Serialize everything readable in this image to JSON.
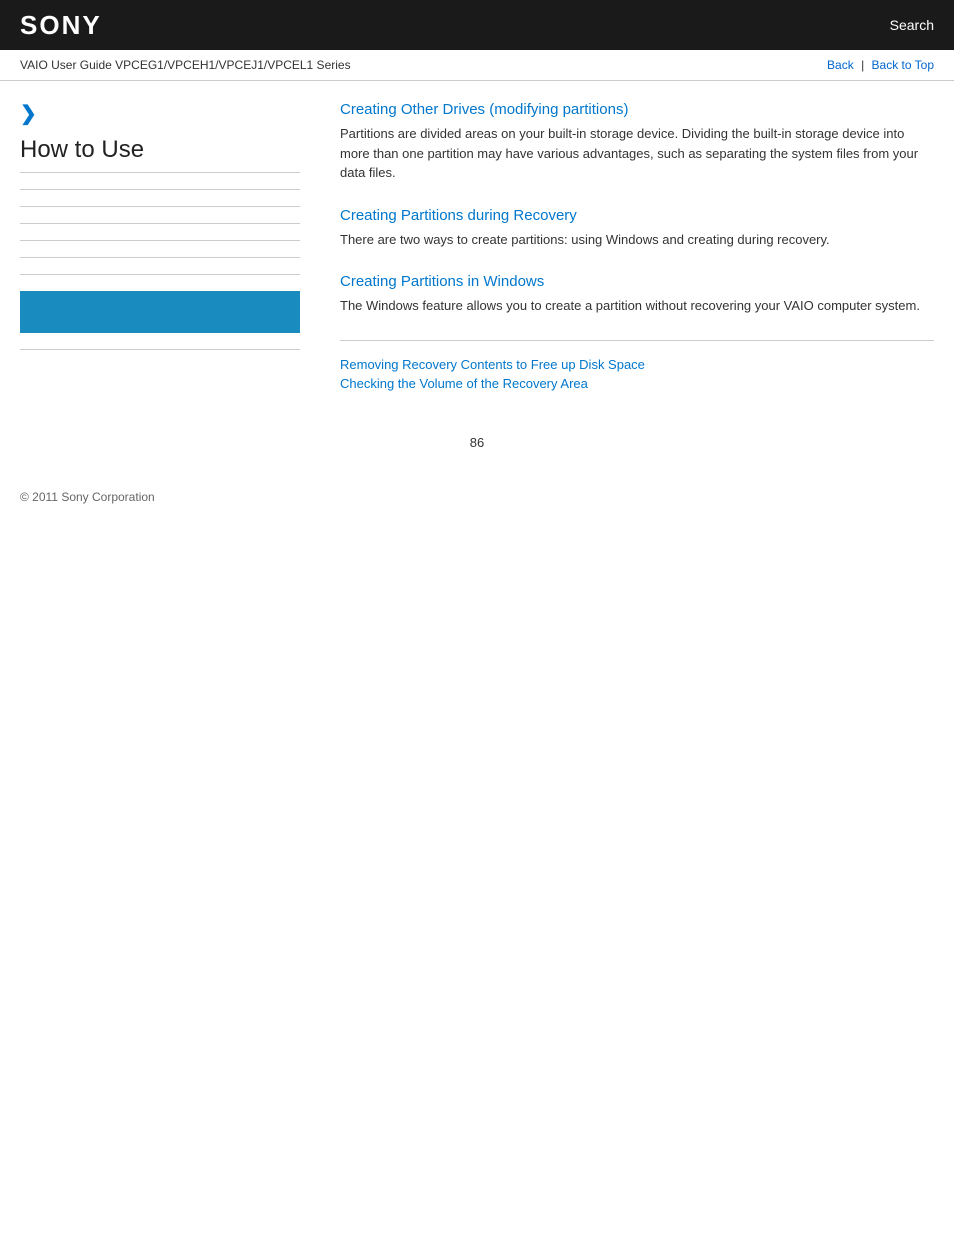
{
  "header": {
    "logo": "SONY",
    "search_label": "Search"
  },
  "breadcrumb": {
    "title": "VAIO User Guide VPCEG1/VPCEH1/VPCEJ1/VPCEL1 Series",
    "back_label": "Back",
    "back_to_top_label": "Back to Top"
  },
  "sidebar": {
    "chevron": "❯",
    "title": "How to Use",
    "highlight_color": "#1a8bbf"
  },
  "content": {
    "sections": [
      {
        "id": "section-other-drives",
        "title": "Creating Other Drives (modifying partitions)",
        "body": "Partitions are divided areas on your built-in storage device. Dividing the built-in storage device into more than one partition may have various advantages, such as separating the system files from your data files."
      },
      {
        "id": "section-partitions-recovery",
        "title": "Creating Partitions during Recovery",
        "body": "There are two ways to create partitions: using Windows and creating during recovery."
      },
      {
        "id": "section-partitions-windows",
        "title": "Creating Partitions in Windows",
        "body": "The Windows feature allows you to create a partition without recovering your VAIO computer system."
      }
    ],
    "links": [
      {
        "id": "link-removing",
        "label": "Removing Recovery Contents to Free up Disk Space"
      },
      {
        "id": "link-checking",
        "label": "Checking the Volume of the Recovery Area"
      }
    ]
  },
  "footer": {
    "copyright": "© 2011 Sony Corporation"
  },
  "page_number": "86"
}
